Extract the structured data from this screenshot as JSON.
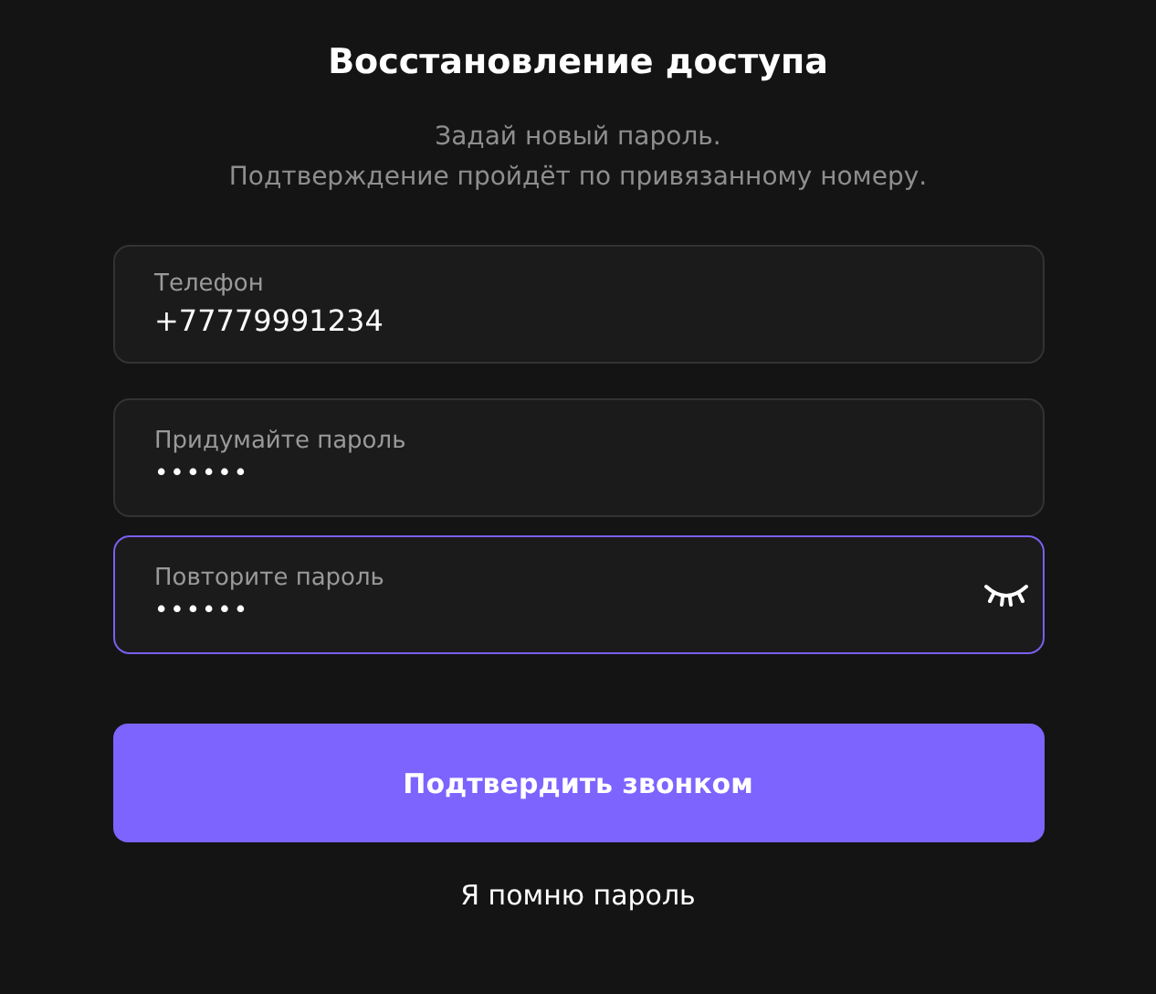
{
  "title": "Восстановление доступа",
  "subtitle": [
    "Задай новый пароль.",
    "Подтверждение пройдёт по привязанному номеру."
  ],
  "fields": [
    {
      "label": "Телефон",
      "value": "+77779991234",
      "kind": "text",
      "focused": false,
      "visibility_toggle": false
    },
    {
      "label": "Придумайте пароль",
      "value": "••••••",
      "kind": "password",
      "focused": false,
      "visibility_toggle": false
    },
    {
      "label": "Повторите пароль",
      "value": "••••••",
      "kind": "password",
      "focused": true,
      "visibility_toggle": true
    }
  ],
  "submit_button": "Подтвердить звонком",
  "link": "Я помню пароль"
}
